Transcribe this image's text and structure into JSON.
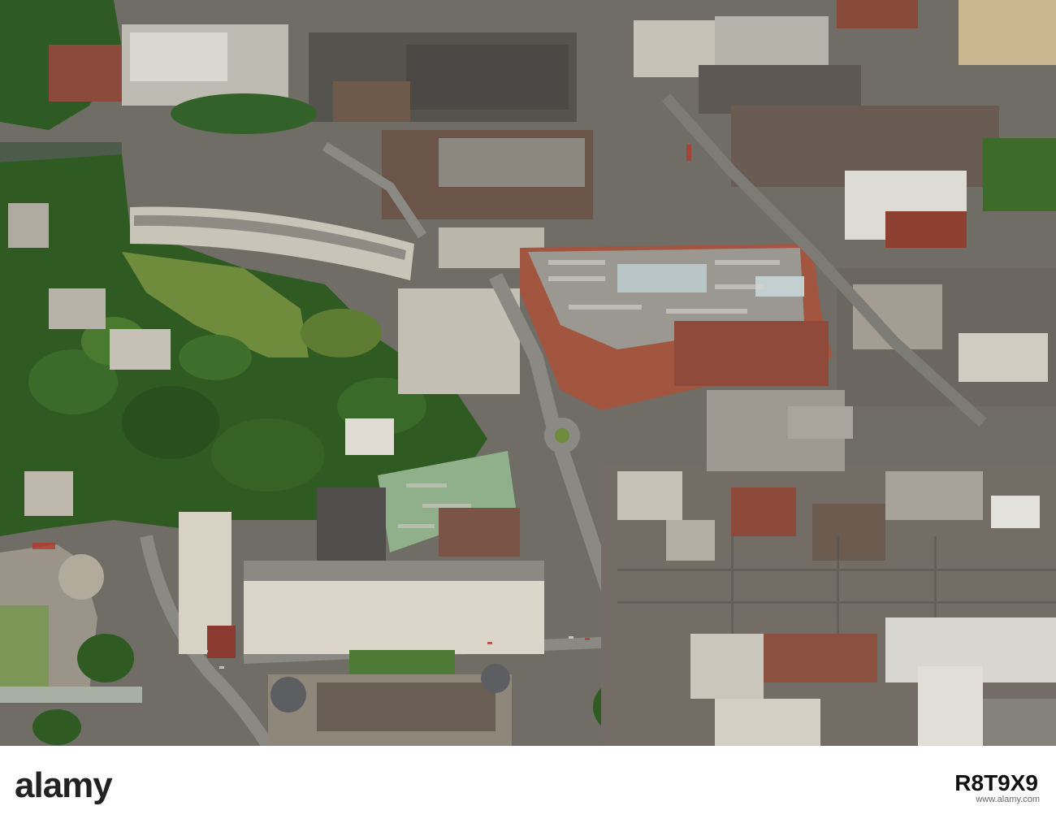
{
  "image": {
    "alt": "Aerial photograph of a seaside town centre with a curved Georgian crescent, wooded gardens, multi-storey car parks, a roundabout and dense terraced streets",
    "colors": {
      "foliage": "#2f5a22",
      "lawn": "#6f8b3c",
      "roof_slate": "#6d6b66",
      "roof_red": "#8e4a3a",
      "stone": "#d8d2c4",
      "road": "#8a8983",
      "carpark_green": "#8fb08b"
    }
  },
  "watermark": {
    "brand": "alamy",
    "image_id": "R8T9X9",
    "url": "www.alamy.com"
  }
}
